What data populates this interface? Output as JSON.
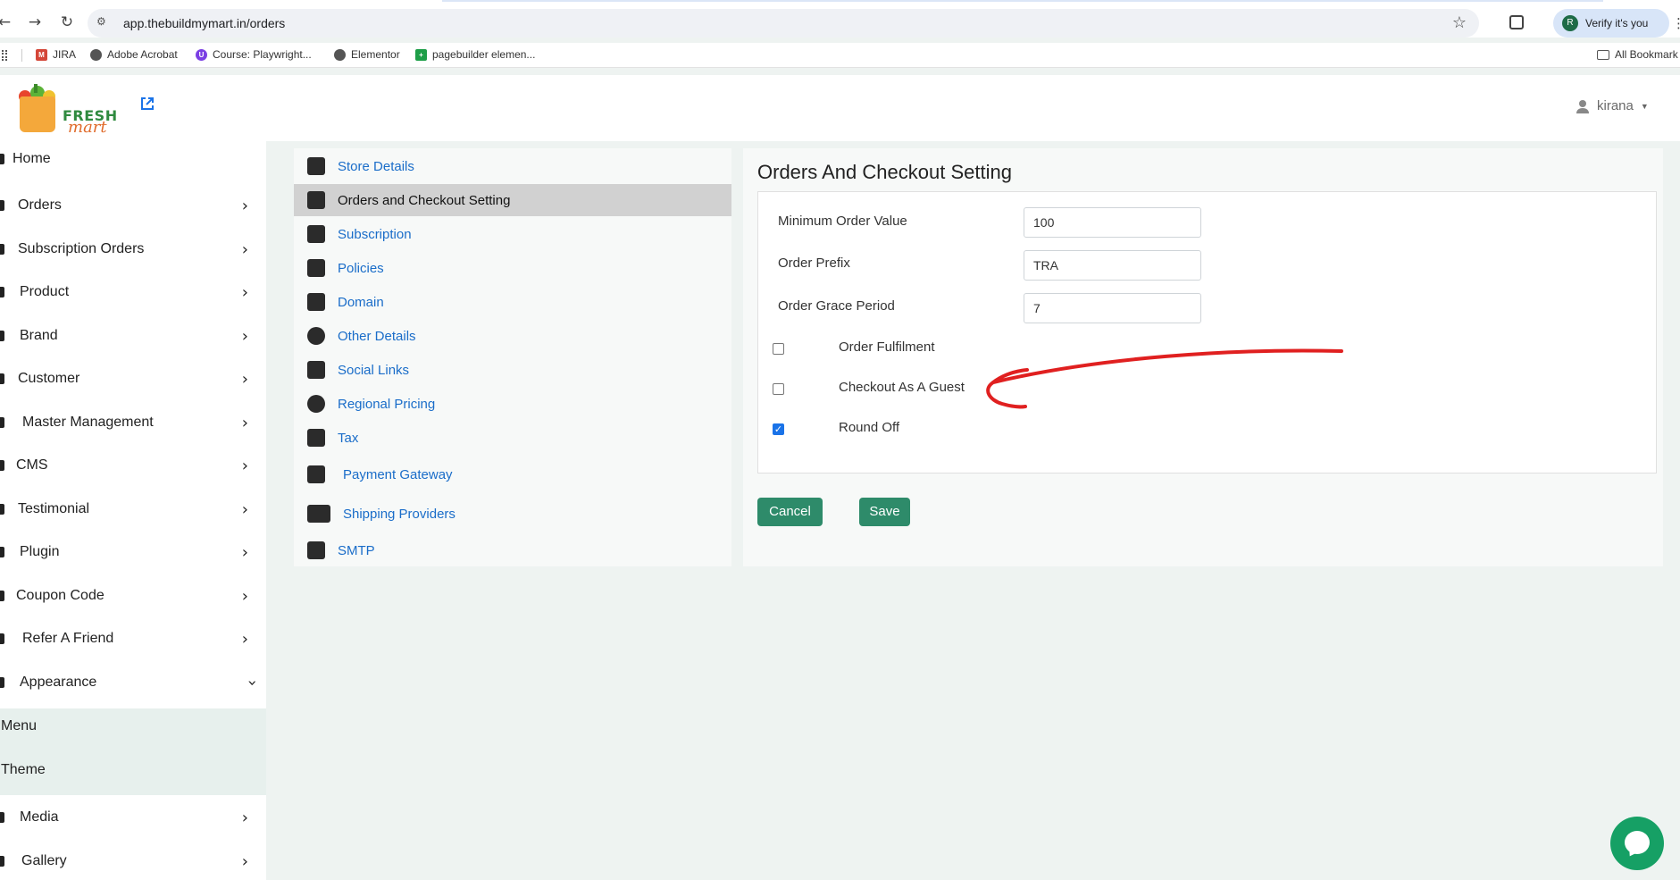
{
  "browser": {
    "url": "app.thebuildmymart.in/orders",
    "verify_label": "Verify it's you",
    "verify_avatar": "R",
    "bookmarks": [
      {
        "label": "JIRA"
      },
      {
        "label": "Adobe Acrobat"
      },
      {
        "label": "Course: Playwright..."
      },
      {
        "label": "Elementor"
      },
      {
        "label": "pagebuilder elemen..."
      }
    ],
    "all_bookmarks": "All Bookmark"
  },
  "header": {
    "logo_top": "FRESH",
    "logo_bottom": "mart",
    "username": "kirana"
  },
  "sidebar": {
    "items": [
      {
        "label": "Home"
      },
      {
        "label": "Orders"
      },
      {
        "label": "Subscription Orders"
      },
      {
        "label": "Product"
      },
      {
        "label": "Brand"
      },
      {
        "label": "Customer"
      },
      {
        "label": "Master Management"
      },
      {
        "label": "CMS"
      },
      {
        "label": "Testimonial"
      },
      {
        "label": "Plugin"
      },
      {
        "label": "Coupon Code"
      },
      {
        "label": "Refer A Friend"
      },
      {
        "label": "Appearance"
      },
      {
        "label": "Menu"
      },
      {
        "label": "Theme"
      },
      {
        "label": "Media"
      },
      {
        "label": "Gallery"
      }
    ]
  },
  "settings_nav": {
    "items": [
      {
        "label": "Store Details"
      },
      {
        "label": "Orders and Checkout Setting"
      },
      {
        "label": "Subscription"
      },
      {
        "label": "Policies"
      },
      {
        "label": "Domain"
      },
      {
        "label": "Other Details"
      },
      {
        "label": "Social Links"
      },
      {
        "label": "Regional Pricing"
      },
      {
        "label": "Tax"
      },
      {
        "label": "Payment Gateway"
      },
      {
        "label": "Shipping Providers"
      },
      {
        "label": "SMTP"
      }
    ],
    "active_index": 1
  },
  "main": {
    "title": "Orders And Checkout Setting",
    "fields": [
      {
        "label": "Minimum Order Value",
        "value": "100"
      },
      {
        "label": "Order Prefix",
        "value": "TRA"
      },
      {
        "label": "Order Grace Period",
        "value": "7"
      }
    ],
    "checkboxes": [
      {
        "label": "Order Fulfilment",
        "checked": false
      },
      {
        "label": "Checkout As A Guest",
        "checked": false
      },
      {
        "label": "Round Off",
        "checked": true
      }
    ],
    "cancel_label": "Cancel",
    "save_label": "Save"
  },
  "colors": {
    "button": "#2e8b6a",
    "link": "#1a6dc9",
    "annotation_arrow": "#e02020",
    "chat": "#16a065"
  },
  "icons": [
    "back-icon",
    "forward-icon",
    "reload-icon",
    "star-icon",
    "extension-icon",
    "user-icon",
    "external-link-icon",
    "chevron-right-icon",
    "chevron-down-icon",
    "chat-icon"
  ]
}
